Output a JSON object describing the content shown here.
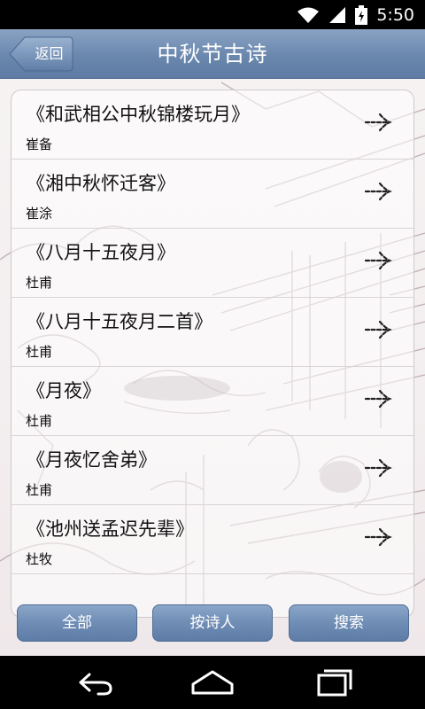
{
  "status_bar": {
    "time": "5:50"
  },
  "header": {
    "back_label": "返回",
    "title": "中秋节古诗"
  },
  "poems": [
    {
      "title": "《和武相公中秋锦楼玩月》",
      "author": "崔备"
    },
    {
      "title": "《湘中秋怀迁客》",
      "author": "崔涂"
    },
    {
      "title": "《八月十五夜月》",
      "author": "杜甫"
    },
    {
      "title": "《八月十五夜月二首》",
      "author": "杜甫"
    },
    {
      "title": "《月夜》",
      "author": "杜甫"
    },
    {
      "title": "《月夜忆舍弟》",
      "author": "杜甫"
    },
    {
      "title": "《池州送孟迟先辈》",
      "author": "杜牧"
    }
  ],
  "footer": {
    "all_label": "全部",
    "by_poet_label": "按诗人",
    "search_label": "搜索"
  },
  "icons": {
    "wifi": "wifi-icon",
    "signal": "signal-icon",
    "battery": "battery-icon",
    "arrow": "arrow-right-icon",
    "back": "back-icon",
    "home": "home-icon",
    "recents": "recents-icon"
  },
  "colors": {
    "accent": "#6a87ad",
    "background": "#f4f0f1"
  }
}
